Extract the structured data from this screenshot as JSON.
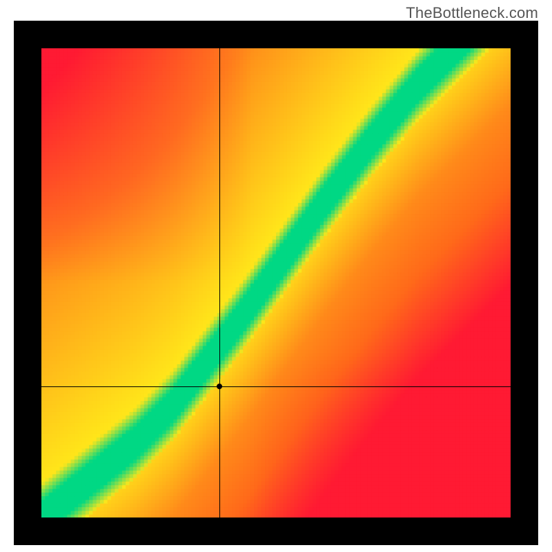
{
  "watermark": "TheBottleneck.com",
  "chart_data": {
    "type": "heatmap",
    "title": "",
    "xlabel": "",
    "ylabel": "",
    "grid": false,
    "x_range": [
      0,
      1
    ],
    "y_range": [
      0,
      1
    ],
    "marker": {
      "x": 0.38,
      "y": 0.28
    },
    "crosshair": {
      "x": 0.38,
      "y": 0.28
    },
    "description": "Color field showing bottleneck match. Green diagonal band = balanced; yellow near band; orange/red far from band.",
    "color_stops_vertical_approx": [
      {
        "t": 0.0,
        "color": "#ff1a33"
      },
      {
        "t": 0.25,
        "color": "#ff6a1a"
      },
      {
        "t": 0.5,
        "color": "#ffd21a"
      },
      {
        "t": 0.78,
        "color": "#00d884"
      },
      {
        "t": 1.0,
        "color": "#ffe61a"
      }
    ],
    "band_center_points": [
      {
        "x": 0.0,
        "y": 0.0
      },
      {
        "x": 0.1,
        "y": 0.08
      },
      {
        "x": 0.2,
        "y": 0.16
      },
      {
        "x": 0.28,
        "y": 0.24
      },
      {
        "x": 0.35,
        "y": 0.33
      },
      {
        "x": 0.42,
        "y": 0.42
      },
      {
        "x": 0.5,
        "y": 0.53
      },
      {
        "x": 0.6,
        "y": 0.67
      },
      {
        "x": 0.7,
        "y": 0.8
      },
      {
        "x": 0.8,
        "y": 0.92
      },
      {
        "x": 0.88,
        "y": 1.0
      }
    ],
    "band_halfwidth_approx": 0.05,
    "resolution_hint": 128
  }
}
